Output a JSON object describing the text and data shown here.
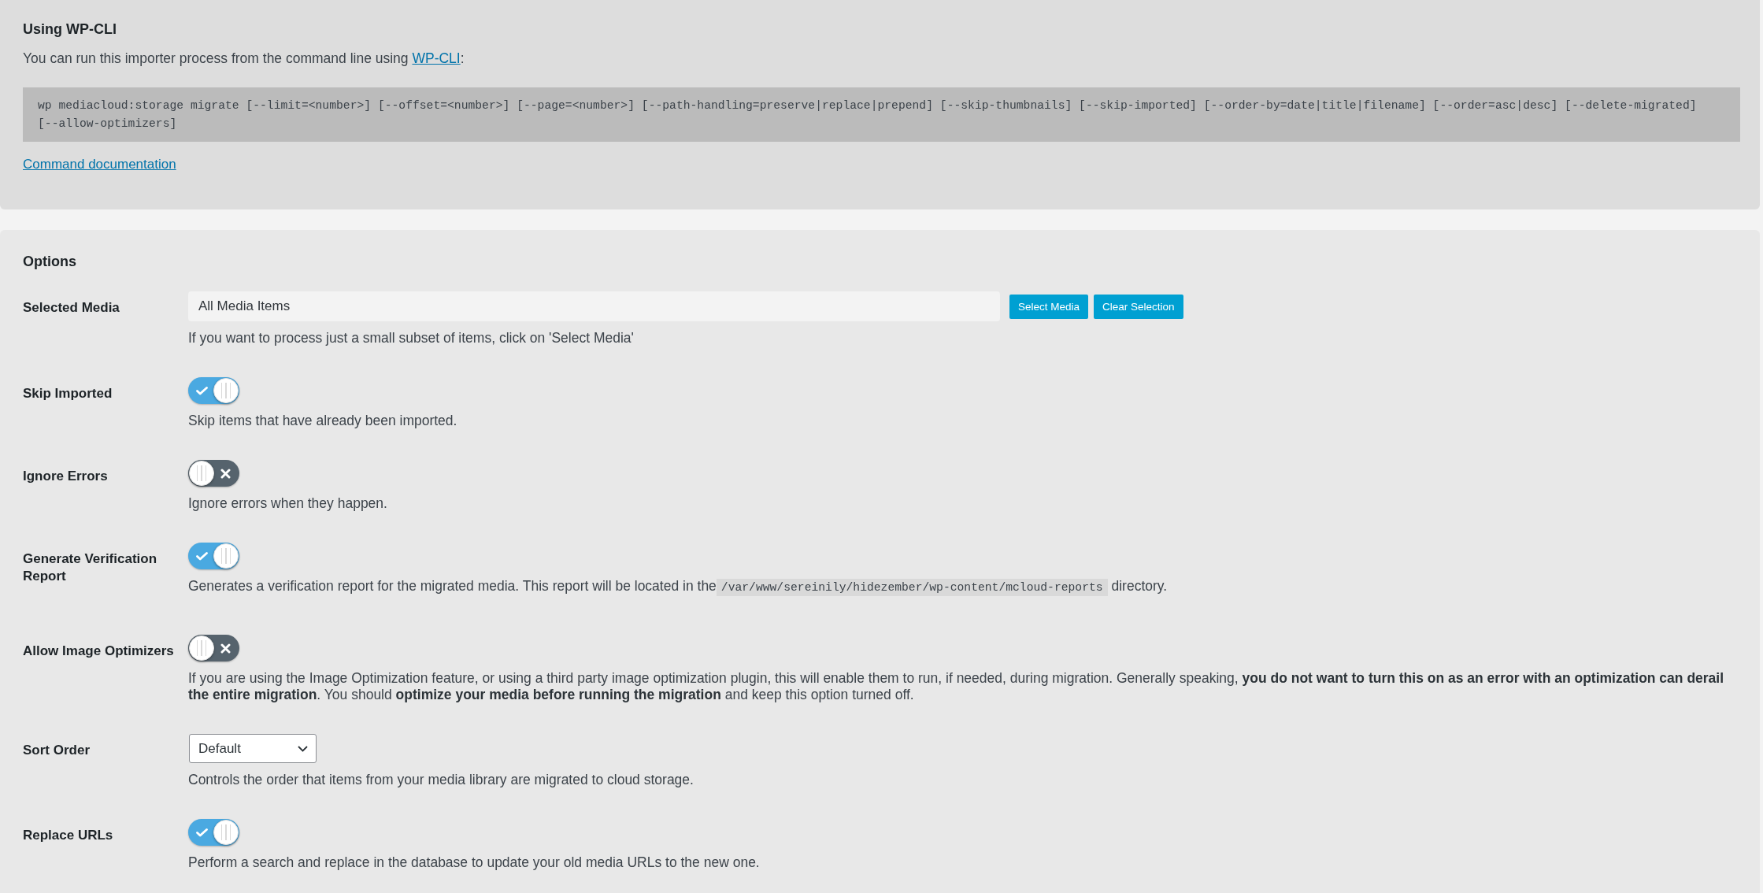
{
  "cli_section": {
    "title": "Using WP-CLI",
    "intro": "You can run this importer process from the command line using",
    "intro_link": "WP-CLI",
    "intro_end": ":",
    "command": "wp mediacloud:storage migrate [--limit=<number>] [--offset=<number>] [--page=<number>] [--path-handling=preserve|replace|prepend] [--skip-thumbnails] [--skip-imported] [--order-by=date|title|filename] [--order=asc|desc] [--delete-migrated] [--allow-optimizers]",
    "doc_link": "Command documentation"
  },
  "options_section": {
    "title": "Options",
    "rows": [
      {
        "kind": "media",
        "label": "Selected Media",
        "value": "All Media Items",
        "buttons": [
          "Select Media",
          "Clear Selection"
        ],
        "help": "If you want to process just a small subset of items, click on 'Select Media'"
      },
      {
        "kind": "toggle",
        "label": "Skip Imported",
        "on": true,
        "help": "Skip items that have already been imported."
      },
      {
        "kind": "toggle",
        "label": "Ignore Errors",
        "on": false,
        "help": "Ignore errors when they happen."
      },
      {
        "kind": "toggle",
        "label": "Generate Verification Report",
        "on": true,
        "help": "Generates a verification report for the migrated media. This report will be located in the",
        "help_code": "/var/www/sereinily/hidezember/wp-content/mcloud-reports",
        "help_after": "directory."
      },
      {
        "kind": "toggle",
        "label": "Allow Image Optimizers",
        "on": false,
        "help": "If you are using the Image Optimization feature, or using a third party image optimization plugin, this will enable them to run, if needed, during migration. Generally speaking, **you do not want to turn this on as an error with an optimization can derail the entire migration**. You should **optimize your media before running the migration** and keep this option turned off."
      },
      {
        "kind": "select",
        "label": "Sort Order",
        "value": "Default",
        "help": "Controls the order that items from your media library are migrated to cloud storage."
      },
      {
        "kind": "toggle",
        "label": "Replace URLs",
        "on": true,
        "help": "Perform a search and replace in the database to update your old media URLs to the new one."
      }
    ]
  }
}
